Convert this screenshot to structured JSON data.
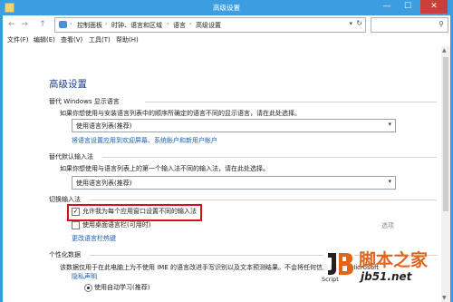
{
  "window": {
    "title": "高级设置",
    "controls": {
      "minimize": "—",
      "maximize": "☐",
      "close": "✕"
    }
  },
  "nav": {
    "back": "←",
    "forward": "→",
    "up": "↑"
  },
  "address": {
    "breadcrumbs": [
      "控制面板",
      "时钟、语言和区域",
      "语言",
      "高级设置"
    ],
    "separator": "›",
    "dropdown": "▾",
    "refresh": "↻"
  },
  "search": {
    "placeholder": "",
    "icon": "search-icon"
  },
  "menubar": [
    "文件(F)",
    "编辑(E)",
    "查看(V)",
    "工具(T)",
    "帮助(H)"
  ],
  "page": {
    "heading": "高级设置",
    "display_language": {
      "title": "替代 Windows 显示语言",
      "description": "如果你想使用与安装语言列表中的顺序所确定的语言不同的显示语言，请在此处选择。",
      "selected": "使用语言列表(推荐)",
      "link": "将语言设置应用到欢迎屏幕、系统帐户和新用户帐户"
    },
    "input_method": {
      "title": "替代默认输入法",
      "description": "如果你想使用与语言列表上的第一个输入法不同的输入法，请在此处选择。",
      "selected": "使用语言列表(推荐)"
    },
    "switch_input": {
      "title": "切换输入法",
      "checkbox1": {
        "label": "允许我为每个应用窗口设置不同的输入法",
        "checked": true
      },
      "checkbox2": {
        "label": "使用桌面语言栏(可用时)",
        "checked": false
      },
      "options_link": "选项",
      "hotkey_link": "更改语言栏热键"
    },
    "personalization": {
      "title": "个性化数据",
      "description": "该数据仅用于在此电脑上为不使用 IME 的语言改进手写识别以及文本预测结果。不会将任何信息发送到 Microsoft",
      "privacy_link": "隐私声明",
      "radio_label": "使用自动学习(推荐)"
    }
  },
  "watermark": {
    "cn_text": "脚本之家",
    "url": "jb51.net",
    "script_text": "Script"
  },
  "colors": {
    "accent": "#3c9ee0",
    "link": "#1a5fb4",
    "heading": "#1e3f8c",
    "highlight_border": "#d4141a",
    "watermark_orange": "#e0651b"
  }
}
